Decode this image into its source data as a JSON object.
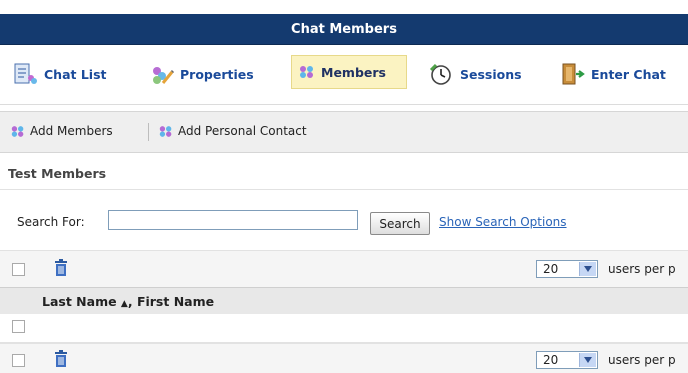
{
  "title": "Chat Members",
  "nav": {
    "items": [
      {
        "label": "Chat List",
        "icon": "chat-list-icon"
      },
      {
        "label": "Properties",
        "icon": "properties-icon"
      },
      {
        "label": "Members",
        "icon": "members-icon",
        "active": true
      },
      {
        "label": "Sessions",
        "icon": "sessions-icon"
      },
      {
        "label": "Enter Chat",
        "icon": "enter-chat-icon"
      }
    ]
  },
  "toolbar": {
    "add_members": "Add Members",
    "add_personal_contact": "Add Personal Contact"
  },
  "section": {
    "title": "Test Members"
  },
  "search": {
    "label": "Search For:",
    "value": "",
    "button": "Search",
    "options_link": "Show Search Options"
  },
  "pagination": {
    "per_page": "20",
    "per_page_label": "users per p"
  },
  "table": {
    "sort_arrow": "▲",
    "column_header_part1": "Last Name ",
    "column_header_part2": ", First Name",
    "rows": []
  },
  "colors": {
    "title_bar": "#143a6f",
    "active_tab": "#fbf3c2",
    "link": "#2a64b8"
  }
}
